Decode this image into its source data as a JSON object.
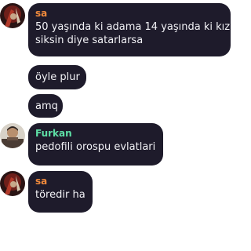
{
  "colors": {
    "bubble_bg": "#1e1b2b",
    "bubble_text": "#f2f2f6",
    "name_sa": "#f08a3c",
    "name_furkan": "#5ee0a6",
    "background": "#ffffff"
  },
  "messages": [
    {
      "author": "sa",
      "avatar_icon": "user-avatar-icon",
      "lines": [
        "50 yaşında ki adama 14 yaşında ki kızı",
        "siksin diye satarlarsa"
      ]
    },
    {
      "text": "öyle plur"
    },
    {
      "text": "amq"
    },
    {
      "author": "Furkan",
      "avatar_icon": "user-avatar-icon",
      "lines": [
        "pedofili orospu evlatlari"
      ]
    },
    {
      "author": "sa",
      "avatar_icon": "user-avatar-icon",
      "lines": [
        "töredir ha"
      ]
    }
  ]
}
